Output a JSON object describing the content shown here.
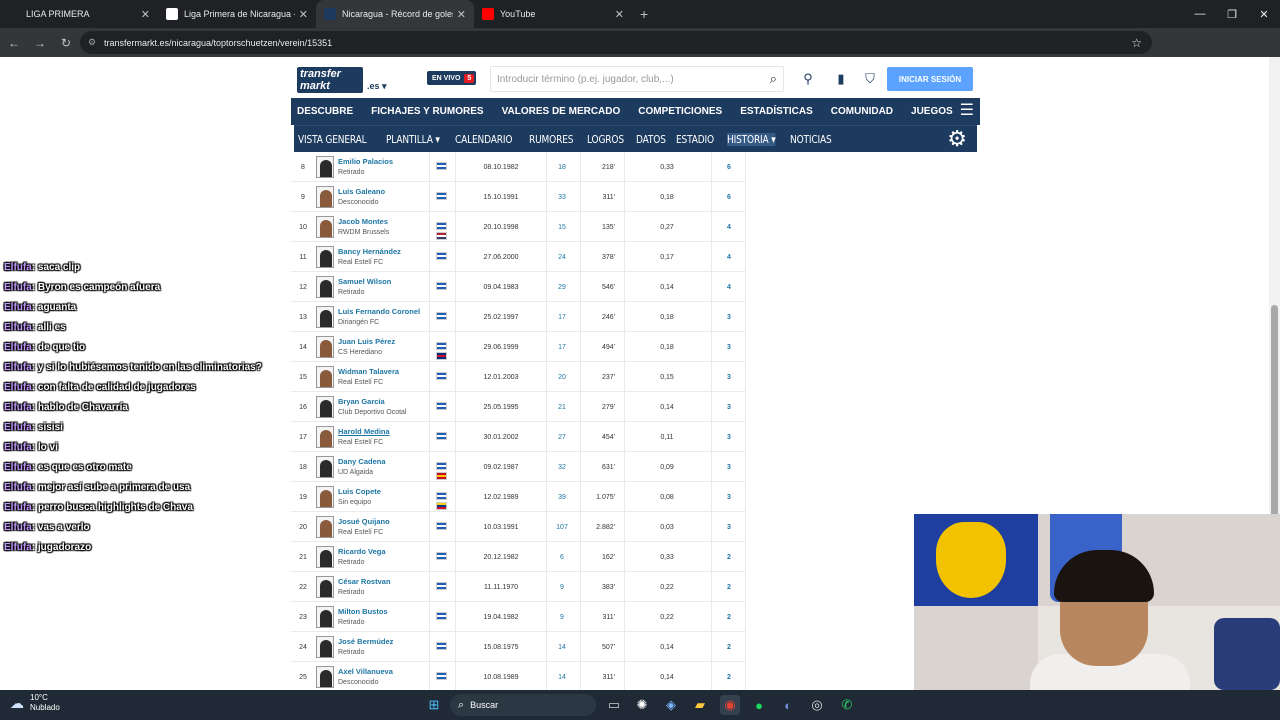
{
  "browser": {
    "tabs": [
      {
        "title": "LIGA PRIMERA",
        "active": false,
        "fav_color": "#202124"
      },
      {
        "title": "Liga Primera de Nicaragua - Wi",
        "active": false,
        "fav_color": "#ffffff"
      },
      {
        "title": "Nicaragua - Récord de goles má",
        "active": true,
        "fav_color": "#1d3a5f"
      },
      {
        "title": "YouTube",
        "active": false,
        "fav_color": "#ff0000"
      }
    ],
    "url": "transfermarkt.es/nicaragua/toptorschuetzen/verein/15351"
  },
  "site": {
    "logo_line1": "transfer",
    "logo_line2": "markt",
    "logo_tld": ".es ▾",
    "live_label": "EN VIVO",
    "live_count": "5",
    "search_placeholder": "Introducir término (p.ej. jugador, club,...)",
    "login_label": "INICIAR SESIÓN",
    "main_nav": [
      "DESCUBRE",
      "FICHAJES Y RUMORES",
      "VALORES DE MERCADO",
      "COMPETICIONES",
      "ESTADÍSTICAS",
      "COMUNIDAD",
      "JUEGOS"
    ],
    "sub_nav": [
      {
        "label": "VISTA GENERAL",
        "selected": false
      },
      {
        "label": "PLANTILLA ▾",
        "selected": false
      },
      {
        "label": "CALENDARIO",
        "selected": false
      },
      {
        "label": "RUMORES",
        "selected": false
      },
      {
        "label": "LOGROS",
        "selected": false
      },
      {
        "label": "DATOS",
        "selected": false
      },
      {
        "label": "ESTADIO",
        "selected": false
      },
      {
        "label": "HISTORIA ▾",
        "selected": true
      },
      {
        "label": "NOTICIAS",
        "selected": false
      }
    ]
  },
  "players": [
    {
      "num": "8",
      "name": "Emilio Palacios",
      "club": "Retirado",
      "flags": [
        "nic"
      ],
      "dob": "08.10.1982",
      "apps": "18",
      "mins": "218'",
      "avg": "0,33",
      "goals": "6",
      "photo": "sil"
    },
    {
      "num": "9",
      "name": "Luis Galeano",
      "club": "Desconocido",
      "flags": [
        "nic"
      ],
      "dob": "15.10.1991",
      "apps": "33",
      "mins": "311'",
      "avg": "0,18",
      "goals": "6",
      "photo": "img"
    },
    {
      "num": "10",
      "name": "Jacob Montes",
      "club": "RWDM Brussels",
      "flags": [
        "nic",
        "usa"
      ],
      "dob": "20.10.1998",
      "apps": "15",
      "mins": "135'",
      "avg": "0,27",
      "goals": "4",
      "photo": "img"
    },
    {
      "num": "11",
      "name": "Bancy Hernández",
      "club": "Real Estelí FC",
      "flags": [
        "nic"
      ],
      "dob": "27.06.2000",
      "apps": "24",
      "mins": "378'",
      "avg": "0,17",
      "goals": "4",
      "photo": "sil"
    },
    {
      "num": "12",
      "name": "Samuel Wilson",
      "club": "Retirado",
      "flags": [
        "nic"
      ],
      "dob": "09.04.1983",
      "apps": "29",
      "mins": "546'",
      "avg": "0,14",
      "goals": "4",
      "photo": "sil"
    },
    {
      "num": "13",
      "name": "Luis Fernando Coronel",
      "club": "Diriangén FC",
      "flags": [
        "nic"
      ],
      "dob": "25.02.1997",
      "apps": "17",
      "mins": "246'",
      "avg": "0,18",
      "goals": "3",
      "photo": "sil"
    },
    {
      "num": "14",
      "name": "Juan Luis Pérez",
      "club": "CS Herediano",
      "flags": [
        "nic",
        "crc"
      ],
      "dob": "29.06.1999",
      "apps": "17",
      "mins": "494'",
      "avg": "0,18",
      "goals": "3",
      "photo": "img"
    },
    {
      "num": "15",
      "name": "Widman Talavera",
      "club": "Real Estelí FC",
      "flags": [
        "nic"
      ],
      "dob": "12.01.2003",
      "apps": "20",
      "mins": "237'",
      "avg": "0,15",
      "goals": "3",
      "photo": "img"
    },
    {
      "num": "16",
      "name": "Bryan García",
      "club": "Club Deportivo Ocotal",
      "flags": [
        "nic"
      ],
      "dob": "25.05.1995",
      "apps": "21",
      "mins": "279'",
      "avg": "0,14",
      "goals": "3",
      "photo": "sil"
    },
    {
      "num": "17",
      "name": "Harold Medina",
      "club": "Real Estelí FC",
      "flags": [
        "nic"
      ],
      "dob": "30.01.2002",
      "apps": "27",
      "mins": "454'",
      "avg": "0,11",
      "goals": "3",
      "photo": "img",
      "hover": true
    },
    {
      "num": "18",
      "name": "Dany Cadena",
      "club": "UD Algaida",
      "flags": [
        "nic",
        "esp"
      ],
      "dob": "09.02.1987",
      "apps": "32",
      "mins": "631'",
      "avg": "0,09",
      "goals": "3",
      "photo": "sil"
    },
    {
      "num": "19",
      "name": "Luis Copete",
      "club": "Sin equipo",
      "flags": [
        "nic",
        "col"
      ],
      "dob": "12.02.1989",
      "apps": "39",
      "mins": "1.075'",
      "avg": "0,08",
      "goals": "3",
      "photo": "img"
    },
    {
      "num": "20",
      "name": "Josué Quijano",
      "club": "Real Estelí FC",
      "flags": [
        "nic"
      ],
      "dob": "10.03.1991",
      "apps": "107",
      "mins": "2.882'",
      "avg": "0,03",
      "goals": "3",
      "photo": "img"
    },
    {
      "num": "21",
      "name": "Ricardo Vega",
      "club": "Retirado",
      "flags": [
        "nic"
      ],
      "dob": "20.12.1982",
      "apps": "6",
      "mins": "162'",
      "avg": "0,33",
      "goals": "2",
      "photo": "sil"
    },
    {
      "num": "22",
      "name": "César Rostvan",
      "club": "Retirado",
      "flags": [
        "nic"
      ],
      "dob": "11.11.1970",
      "apps": "9",
      "mins": "383'",
      "avg": "0,22",
      "goals": "2",
      "photo": "sil"
    },
    {
      "num": "23",
      "name": "Milton Bustos",
      "club": "Retirado",
      "flags": [
        "nic"
      ],
      "dob": "19.04.1982",
      "apps": "9",
      "mins": "311'",
      "avg": "0,22",
      "goals": "2",
      "photo": "sil"
    },
    {
      "num": "24",
      "name": "José Bermúdez",
      "club": "Retirado",
      "flags": [
        "nic"
      ],
      "dob": "15.08.1975",
      "apps": "14",
      "mins": "507'",
      "avg": "0,14",
      "goals": "2",
      "photo": "sil"
    },
    {
      "num": "25",
      "name": "Axel Villanueva",
      "club": "Desconocido",
      "flags": [
        "nic"
      ],
      "dob": "10.08.1989",
      "apps": "14",
      "mins": "311'",
      "avg": "0,14",
      "goals": "2",
      "photo": "sil"
    }
  ],
  "chat": [
    {
      "user": "Elfufa",
      "msg": ": saca clip"
    },
    {
      "user": "Elfufa",
      "msg": ": Byron es campeón afuera"
    },
    {
      "user": "Elfufa",
      "msg": ": aguanta"
    },
    {
      "user": "Elfufa",
      "msg": ": alli es"
    },
    {
      "user": "Elfufa",
      "msg": ": de que tio"
    },
    {
      "user": "Elfufa",
      "msg": ": y si lo hubiésemos tenido en las eliminatorias?",
      "wrap": true
    },
    {
      "user": "Elfufa",
      "msg": ": con falta de calidad de jugadores"
    },
    {
      "user": "Elfufa",
      "msg": ": hablo de Chavarría"
    },
    {
      "user": "Elfufa",
      "msg": ": sisisi"
    },
    {
      "user": "Elfufa",
      "msg": ": lo vi"
    },
    {
      "user": "Elfufa",
      "msg": ": es que es otro mate"
    },
    {
      "user": "Elfufa",
      "msg": ": mejor así sube a primera de usa"
    },
    {
      "user": "Elfufa",
      "msg": ": perro busca highlights de Chava"
    },
    {
      "user": "Elfufa",
      "msg": ": vas a verlo"
    },
    {
      "user": "Elfufa",
      "msg": ": jugadorazo"
    }
  ],
  "taskbar": {
    "temp": "10°C",
    "weather": "Nublado",
    "search_label": "Buscar"
  },
  "colors": {
    "brand": "#1d3a5f",
    "link": "#1d75a3",
    "login": "#5ba3ff",
    "chat_user": "#c39bff"
  }
}
